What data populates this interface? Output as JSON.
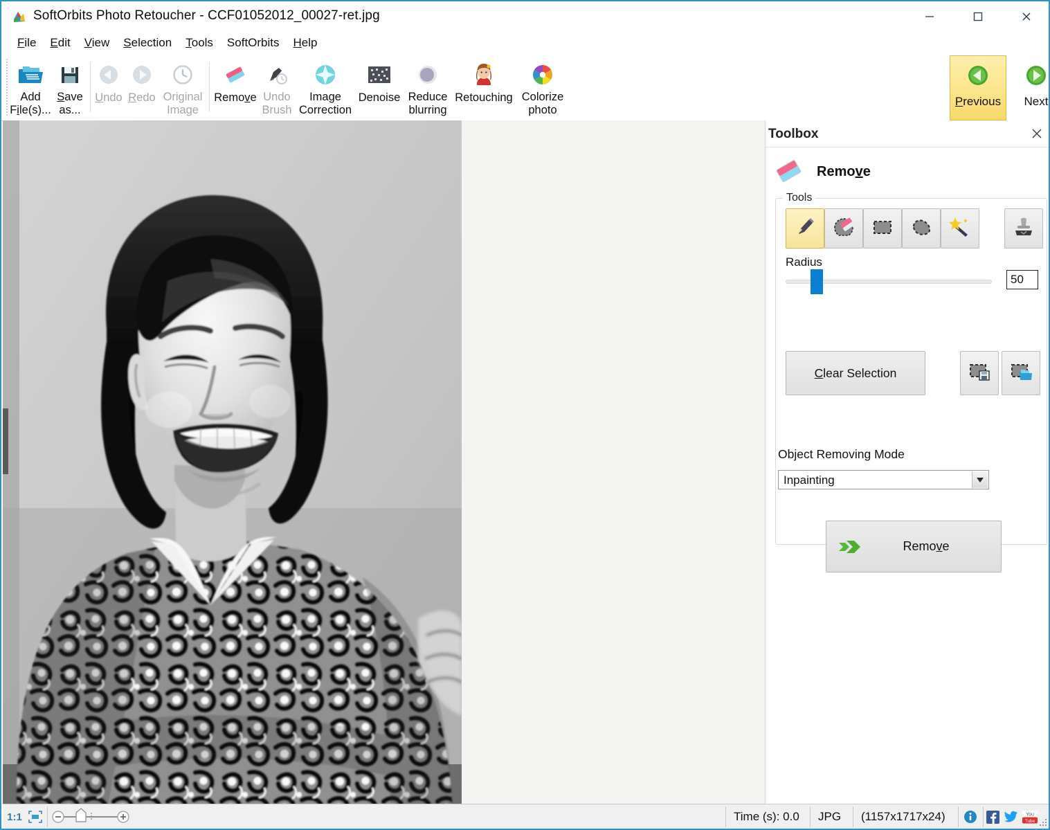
{
  "window": {
    "title": "SoftOrbits Photo Retoucher - CCF01052012_00027-ret.jpg",
    "app_icon": "softorbits-logo-icon",
    "minimize_label": "—",
    "maximize_label": "□",
    "close_label": "✕"
  },
  "menu": [
    {
      "label": "File",
      "accel": "F"
    },
    {
      "label": "Edit",
      "accel": "E"
    },
    {
      "label": "View",
      "accel": "V"
    },
    {
      "label": "Selection",
      "accel": "S"
    },
    {
      "label": "Tools",
      "accel": "T"
    },
    {
      "label": "SoftOrbits",
      "accel": ""
    },
    {
      "label": "Help",
      "accel": "H"
    }
  ],
  "toolbar": {
    "buttons": [
      {
        "name": "add-files",
        "line1": "Add",
        "line2": "File(s)...",
        "accel": "i",
        "icon": "open-folder-icon",
        "disabled": false
      },
      {
        "name": "save-as",
        "line1": "Save",
        "line2": "as...",
        "accel": "S",
        "icon": "floppy-disk-icon",
        "disabled": false
      },
      {
        "name": "undo",
        "line1": "Undo",
        "line2": "",
        "accel": "U",
        "icon": "arrow-left-circle-icon",
        "disabled": true
      },
      {
        "name": "redo",
        "line1": "Redo",
        "line2": "",
        "accel": "R",
        "icon": "arrow-right-circle-icon",
        "disabled": true
      },
      {
        "name": "original-image",
        "line1": "Original",
        "line2": "Image",
        "accel": "",
        "icon": "clock-history-icon",
        "disabled": true
      },
      {
        "name": "remove",
        "line1": "Remove",
        "line2": "",
        "accel": "v",
        "icon": "eraser-icon",
        "disabled": false
      },
      {
        "name": "undo-brush",
        "line1": "Undo",
        "line2": "Brush",
        "accel": "",
        "icon": "brush-history-icon",
        "disabled": true
      },
      {
        "name": "image-correction",
        "line1": "Image",
        "line2": "Correction",
        "accel": "",
        "icon": "sparkle-star-icon",
        "disabled": false
      },
      {
        "name": "denoise",
        "line1": "Denoise",
        "line2": "",
        "accel": "",
        "icon": "noise-grid-icon",
        "disabled": false
      },
      {
        "name": "reduce-blurring",
        "line1": "Reduce",
        "line2": "blurring",
        "accel": "",
        "icon": "blur-circle-icon",
        "disabled": false
      },
      {
        "name": "retouching",
        "line1": "Retouching",
        "line2": "",
        "accel": "",
        "icon": "portrait-woman-icon",
        "disabled": false
      },
      {
        "name": "colorize-photo",
        "line1": "Colorize",
        "line2": "photo",
        "accel": "",
        "icon": "color-wheel-icon",
        "disabled": false
      }
    ],
    "previous": {
      "label": "Previous",
      "accel": "P",
      "icon": "green-left-arrow-icon",
      "active": true
    },
    "next": {
      "label": "Next",
      "accel": "N",
      "icon": "green-right-arrow-icon",
      "active": false
    },
    "expand_icon": "ribbon-expand-chevron-icon"
  },
  "toolbox": {
    "panel_title": "Toolbox",
    "close_icon": "close-icon",
    "mode_icon": "eraser-icon",
    "mode_name": "Remove",
    "mode_accel": "v",
    "tools_group_label": "Tools",
    "tools": [
      {
        "name": "pencil-tool",
        "icon": "pencil-icon",
        "selected": true
      },
      {
        "name": "eraser-tool",
        "icon": "eraser-circle-icon",
        "selected": false
      },
      {
        "name": "rectangle-select-tool",
        "icon": "rect-marquee-icon",
        "selected": false
      },
      {
        "name": "lasso-select-tool",
        "icon": "lasso-icon",
        "selected": false
      },
      {
        "name": "magic-wand-tool",
        "icon": "magic-wand-icon",
        "selected": false
      }
    ],
    "stamp_tool": {
      "name": "stamp-tool",
      "icon": "rubber-stamp-icon",
      "selected": false
    },
    "radius_label": "Radius",
    "radius_value": "50",
    "radius_min": 1,
    "radius_max": 200,
    "clear_selection_label": "Clear Selection",
    "clear_selection_accel": "C",
    "save_selection_icon": "save-selection-icon",
    "load_selection_icon": "load-selection-icon",
    "object_removing_mode_label": "Object Removing Mode",
    "object_removing_mode_value": "Inpainting",
    "object_removing_mode_options": [
      "Inpainting"
    ],
    "dropdown_arrow_icon": "chevron-down-icon",
    "remove_button_label": "Remove",
    "remove_button_accel": "v",
    "remove_button_icon": "green-double-arrow-icon"
  },
  "canvas": {
    "photo_alt": "black-and-white vintage portrait of a smiling woman with arms folded wearing a floral patterned blouse",
    "background_color": "#f4f4f2"
  },
  "statusbar": {
    "zoom_1to1_label": "1:1",
    "zoom_fit_icon": "fit-to-window-icon",
    "zoom_out_icon": "minus-circle-icon",
    "zoom_in_icon": "plus-circle-icon",
    "zoom_home_icon": "zoom-home-marker-icon",
    "time_label": "Time (s): 0.0",
    "format_label": "JPG",
    "dimensions_label": "(1157x1717x24)",
    "info_icon": "info-icon",
    "social": [
      {
        "name": "facebook-icon",
        "label": "f"
      },
      {
        "name": "twitter-icon",
        "label": ""
      },
      {
        "name": "youtube-icon",
        "label": "You"
      }
    ],
    "resize_grip_icon": "resize-grip-icon"
  },
  "colors": {
    "accent_blue": "#2f93c8",
    "highlight_yellow": "#f7d96a",
    "slider_blue": "#0b7fd4",
    "green": "#3fa62a",
    "panel_bg": "#ffffff"
  }
}
